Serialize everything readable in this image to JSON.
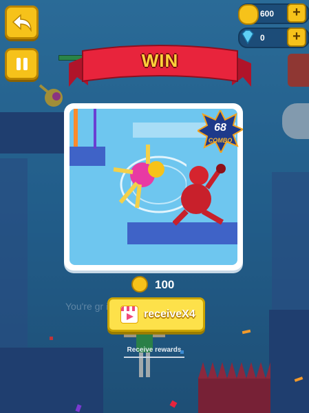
{
  "currency": {
    "coins": "600",
    "gems": "0",
    "plus_label": "+"
  },
  "banner": {
    "title": "WIN"
  },
  "combo": {
    "count": "68",
    "label": "COMBO"
  },
  "reward": {
    "amount": "100"
  },
  "background_text": "You're gr              ing me",
  "cta": {
    "label": "receiveX4",
    "icon": "video-clapper-icon"
  },
  "secondary": {
    "label": "Receive rewards"
  },
  "colors": {
    "banner_red": "#e8243c",
    "gold": "#f6c21a",
    "cta_yellow": "#fde14a",
    "panel_sky": "#6ec6ef"
  }
}
